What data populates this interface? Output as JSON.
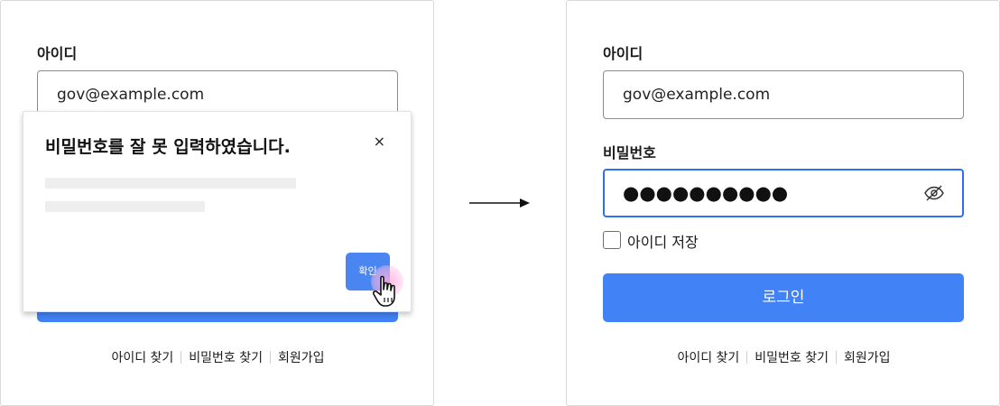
{
  "before": {
    "id_label": "아이디",
    "id_value": "gov@example.com",
    "login_button": "",
    "links": [
      "아이디 찾기",
      "비밀번호 찾기",
      "회원가입"
    ],
    "modal": {
      "title": "비밀번호를 잘 못 입력하였습니다.",
      "close": "×",
      "confirm_label": "확인"
    }
  },
  "after": {
    "id_label": "아이디",
    "id_value": "gov@example.com",
    "pw_label": "비밀번호",
    "pw_value": "●●●●●●●●●●",
    "remember_label": "아이디 저장",
    "login_button": "로그인",
    "links": [
      "아이디 찾기",
      "비밀번호 찾기",
      "회원가입"
    ]
  },
  "colors": {
    "accent": "#4282f7",
    "focus_border": "#2b6ff2"
  },
  "icons": {
    "eye": "eye-off-icon",
    "close": "close-icon",
    "cursor": "hand-pointer-icon",
    "arrow": "arrow-right-icon"
  }
}
